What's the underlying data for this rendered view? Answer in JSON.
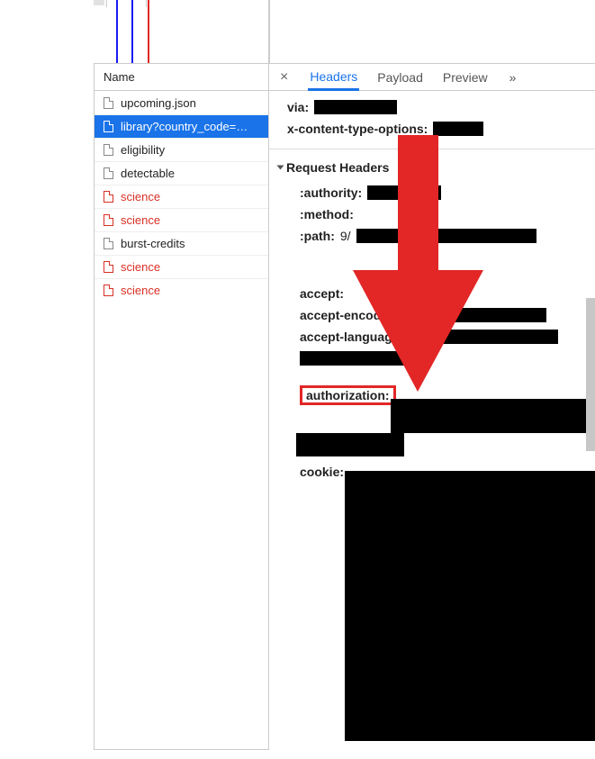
{
  "timeline": {},
  "name_pane": {
    "header": "Name",
    "rows": [
      {
        "label": "upcoming.json",
        "selected": false,
        "red": false
      },
      {
        "label": "library?country_code=…",
        "selected": true,
        "red": false
      },
      {
        "label": "eligibility",
        "selected": false,
        "red": false
      },
      {
        "label": "detectable",
        "selected": false,
        "red": false
      },
      {
        "label": "science",
        "selected": false,
        "red": true
      },
      {
        "label": "science",
        "selected": false,
        "red": true
      },
      {
        "label": "burst-credits",
        "selected": false,
        "red": false
      },
      {
        "label": "science",
        "selected": false,
        "red": true
      },
      {
        "label": "science",
        "selected": false,
        "red": true
      }
    ]
  },
  "tabs": {
    "close": "×",
    "items": [
      {
        "label": "Headers",
        "active": true
      },
      {
        "label": "Payload",
        "active": false
      },
      {
        "label": "Preview",
        "active": false
      }
    ],
    "more": "»"
  },
  "headers": {
    "top": [
      {
        "key": "via:",
        "redact_w": 92
      },
      {
        "key": "x-content-type-options:",
        "redact_w": 56
      }
    ],
    "section_title": "Request Headers",
    "req": [
      {
        "key": ":authority:",
        "redact_w": 82
      },
      {
        "key": ":method:",
        "redact_w": 0
      },
      {
        "key": ":path:",
        "mid": "9/",
        "redact_w": 200
      }
    ],
    "lower": [
      {
        "key": "accept:",
        "redact_w": 0
      },
      {
        "key": "accept-encoding:",
        "redact_w": 152
      },
      {
        "key": "accept-language:",
        "redact_w": 166
      }
    ],
    "lower_extra_redact_w": 142,
    "authorization_key": "authorization:",
    "cookie_key": "cookie:"
  },
  "annotation": {
    "arrow_color": "#e32626",
    "highlight_target": "authorization"
  }
}
